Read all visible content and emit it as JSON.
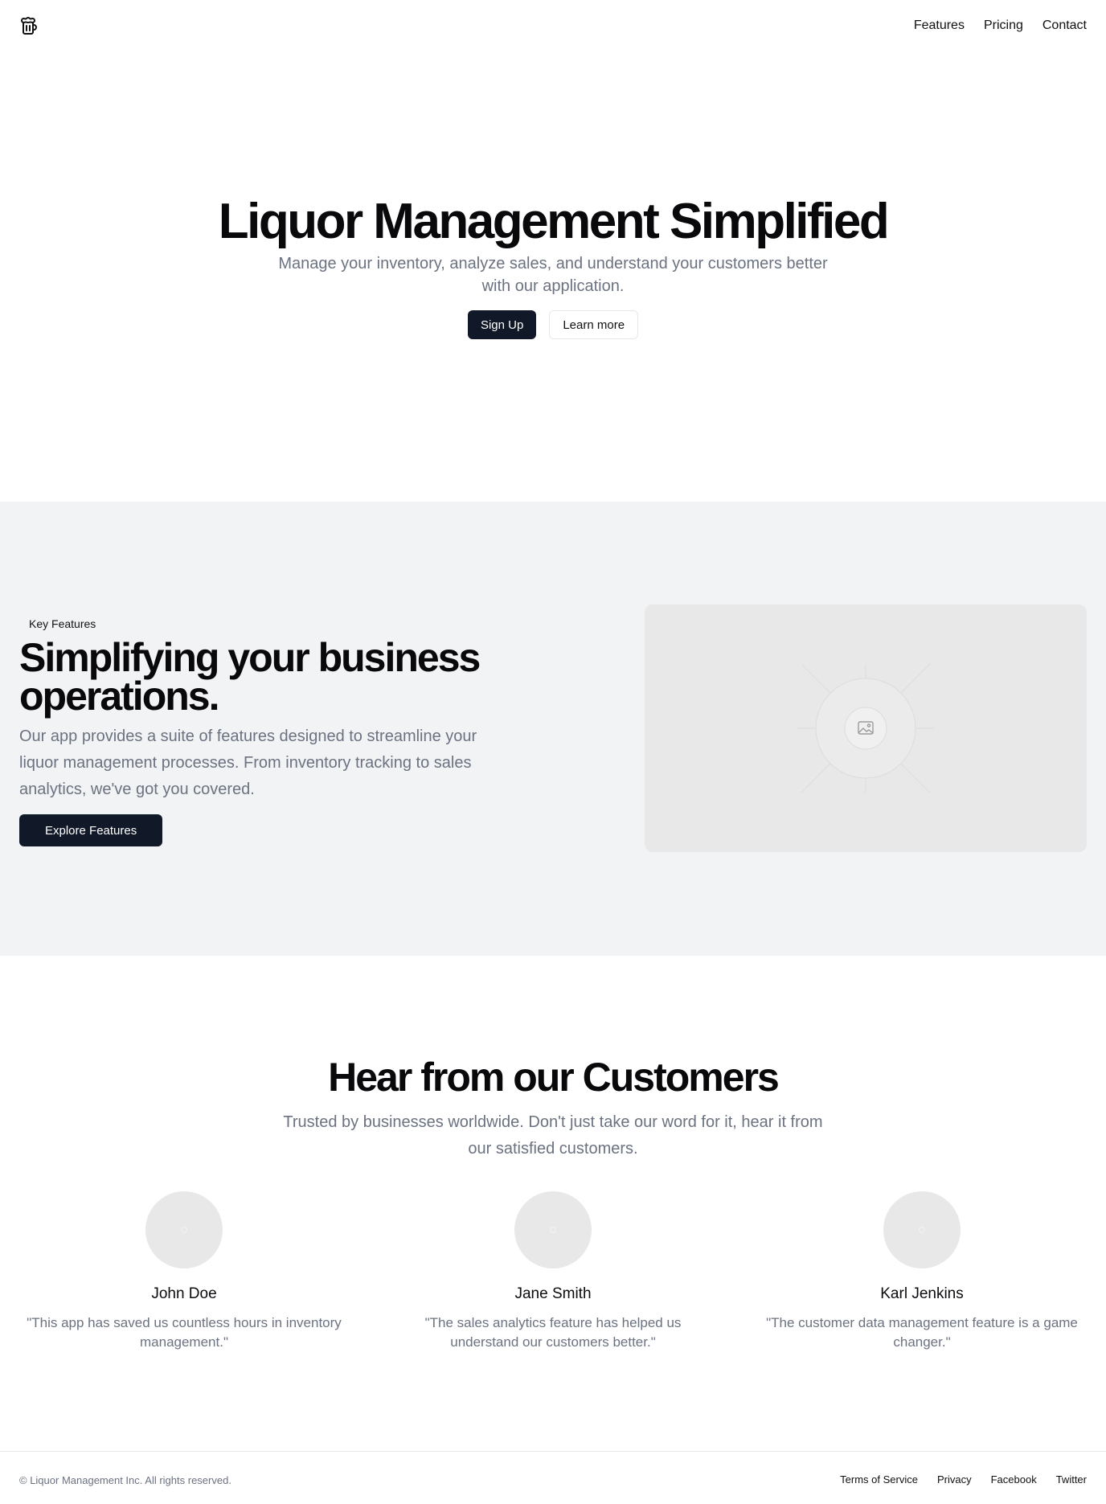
{
  "header": {
    "logo_icon": "beer-mug-icon",
    "nav": [
      "Features",
      "Pricing",
      "Contact"
    ]
  },
  "hero": {
    "title": "Liquor Management Simplified",
    "subtitle": "Manage your inventory, analyze sales, and understand your customers better with our application.",
    "primary_button": "Sign Up",
    "secondary_button": "Learn more"
  },
  "features": {
    "tag": "Key Features",
    "title": "Simplifying your business operations.",
    "description": "Our app provides a suite of features designed to streamline your liquor management processes. From inventory tracking to sales analytics, we've got you covered.",
    "button": "Explore Features",
    "image_icon": "image-placeholder-icon"
  },
  "testimonials": {
    "title": "Hear from our Customers",
    "subtitle": "Trusted by businesses worldwide. Don't just take our word for it, hear it from our satisfied customers.",
    "items": [
      {
        "name": "John Doe",
        "quote": "\"This app has saved us countless hours in inventory management.\""
      },
      {
        "name": "Jane Smith",
        "quote": "\"The sales analytics feature has helped us understand our customers better.\""
      },
      {
        "name": "Karl Jenkins",
        "quote": "\"The customer data management feature is a game changer.\""
      }
    ]
  },
  "footer": {
    "copyright": "© Liquor Management Inc. All rights reserved.",
    "links": [
      "Terms of Service",
      "Privacy",
      "Facebook",
      "Twitter"
    ]
  },
  "colors": {
    "primary": "#111827",
    "muted_text": "#6b7280",
    "section_bg": "#f2f3f5",
    "placeholder_bg": "#e8e8e8"
  }
}
